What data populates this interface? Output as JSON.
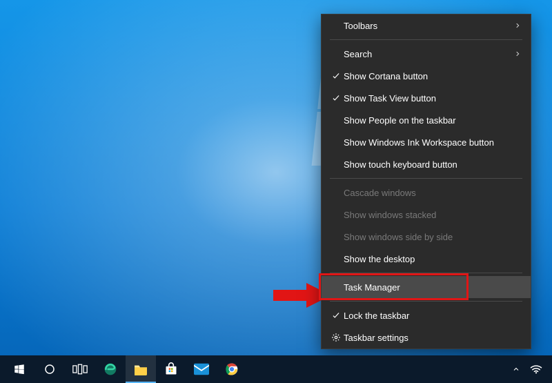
{
  "context_menu": {
    "items": [
      {
        "label": "Toolbars",
        "checked": false,
        "disabled": false,
        "submenu": true,
        "iconBefore": ""
      },
      {
        "separator": true
      },
      {
        "label": "Search",
        "checked": false,
        "disabled": false,
        "submenu": true,
        "iconBefore": ""
      },
      {
        "label": "Show Cortana button",
        "checked": true,
        "disabled": false,
        "submenu": false,
        "iconBefore": ""
      },
      {
        "label": "Show Task View button",
        "checked": true,
        "disabled": false,
        "submenu": false,
        "iconBefore": ""
      },
      {
        "label": "Show People on the taskbar",
        "checked": false,
        "disabled": false,
        "submenu": false,
        "iconBefore": ""
      },
      {
        "label": "Show Windows Ink Workspace button",
        "checked": false,
        "disabled": false,
        "submenu": false,
        "iconBefore": ""
      },
      {
        "label": "Show touch keyboard button",
        "checked": false,
        "disabled": false,
        "submenu": false,
        "iconBefore": ""
      },
      {
        "separator": true
      },
      {
        "label": "Cascade windows",
        "checked": false,
        "disabled": true,
        "submenu": false,
        "iconBefore": ""
      },
      {
        "label": "Show windows stacked",
        "checked": false,
        "disabled": true,
        "submenu": false,
        "iconBefore": ""
      },
      {
        "label": "Show windows side by side",
        "checked": false,
        "disabled": true,
        "submenu": false,
        "iconBefore": ""
      },
      {
        "label": "Show the desktop",
        "checked": false,
        "disabled": false,
        "submenu": false,
        "iconBefore": ""
      },
      {
        "separator": true
      },
      {
        "label": "Task Manager",
        "checked": false,
        "disabled": false,
        "submenu": false,
        "iconBefore": "",
        "hover": true,
        "highlight": true
      },
      {
        "separator": true
      },
      {
        "label": "Lock the taskbar",
        "checked": true,
        "disabled": false,
        "submenu": false,
        "iconBefore": ""
      },
      {
        "label": "Taskbar settings",
        "checked": false,
        "disabled": false,
        "submenu": false,
        "iconBefore": "gear"
      }
    ]
  },
  "taskbar": {
    "items": [
      {
        "name": "start-button",
        "icon": "windows"
      },
      {
        "name": "cortana-button",
        "icon": "circle"
      },
      {
        "name": "task-view-button",
        "icon": "taskview"
      },
      {
        "name": "edge-icon",
        "icon": "edge"
      },
      {
        "name": "file-explorer-icon",
        "icon": "folder",
        "active": true
      },
      {
        "name": "microsoft-store-icon",
        "icon": "store"
      },
      {
        "name": "mail-icon",
        "icon": "mail"
      },
      {
        "name": "chrome-icon",
        "icon": "chrome"
      }
    ],
    "tray": [
      {
        "name": "tray-chevron-icon",
        "icon": "chevron-up"
      },
      {
        "name": "wifi-icon",
        "icon": "wifi"
      }
    ]
  },
  "annotation": {
    "arrow_color": "#e11515",
    "highlight_color": "#e11515"
  }
}
